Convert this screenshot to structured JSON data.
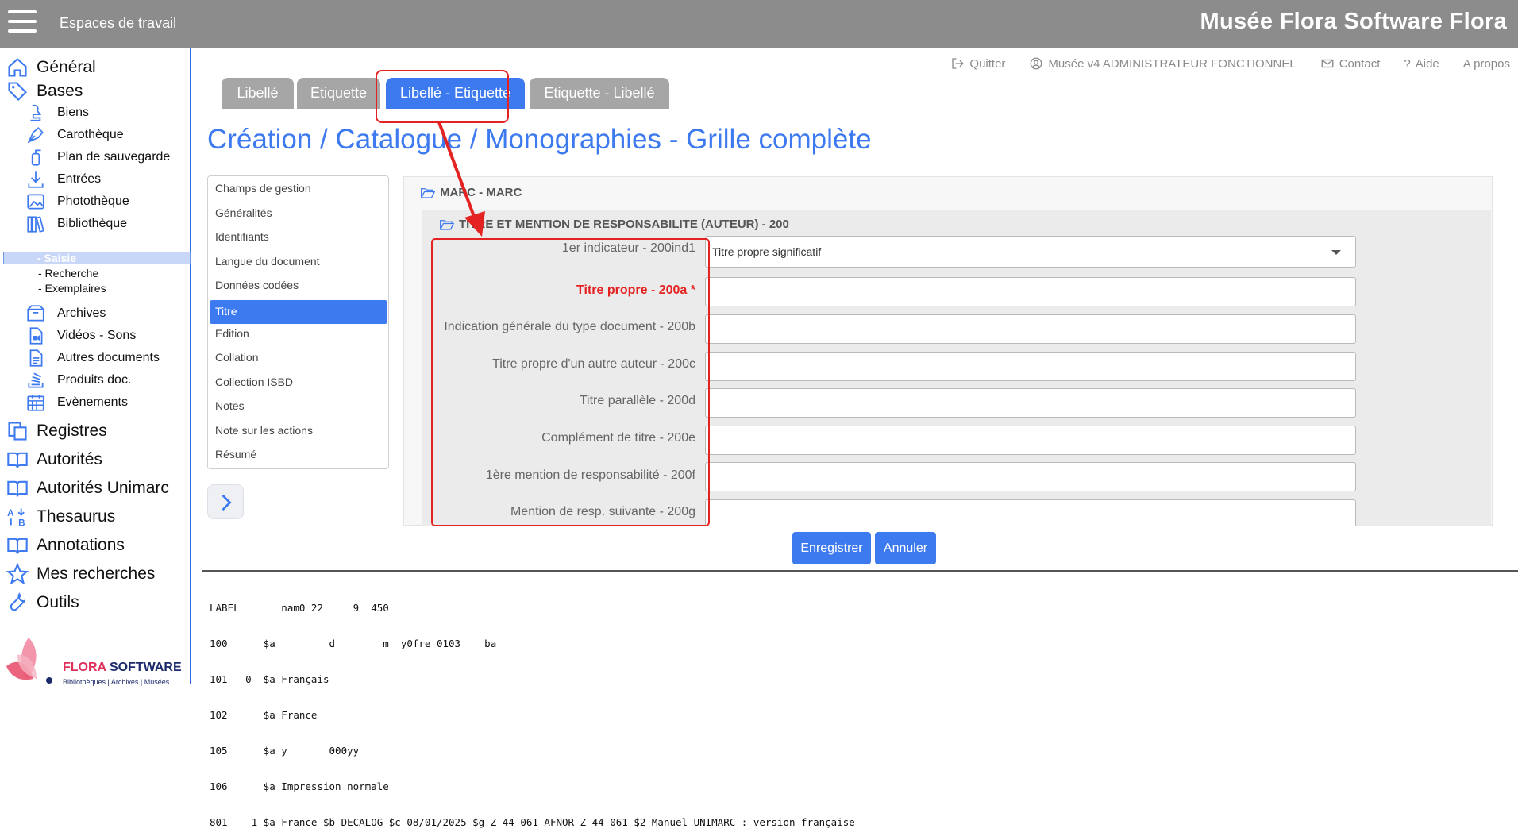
{
  "topbar": {
    "workspaces": "Espaces de travail",
    "brand": "Musée Flora Software Flora"
  },
  "sidebar": {
    "general": "Général",
    "bases": "Bases",
    "subs": [
      "Biens",
      "Carothèque",
      "Plan de sauvegarde",
      "Entrées",
      "Photothèque",
      "Bibliothèque"
    ],
    "biblio_leaves": [
      "- Saisie",
      "- Recherche",
      "- Exemplaires"
    ],
    "subs2": [
      "Archives",
      "Vidéos - Sons",
      "Autres documents",
      "Produits doc.",
      "Evènements"
    ],
    "tops": [
      "Registres",
      "Autorités",
      "Autorités Unimarc",
      "Thesaurus",
      "Annotations",
      "Mes recherches",
      "Outils"
    ],
    "logo": {
      "brand_a": "FLORA ",
      "brand_b": "SOFTWARE",
      "tagline": "Bibliothèques | Archives | Musées"
    }
  },
  "header_links": {
    "quit": "Quitter",
    "user": "Musée v4 ADMINISTRATEUR FONCTIONNEL",
    "contact": "Contact",
    "help": "Aide",
    "about": "A propos"
  },
  "tabs": [
    "Libellé",
    "Etiquette",
    "Libellé - Etiquette",
    "Etiquette - Libellé"
  ],
  "page_title": "Création / Catalogue / Monographies - Grille complète",
  "field_groups": [
    "Champs de gestion",
    "Généralités",
    "Identifiants",
    "Langue du document",
    "Données codées",
    "Titre",
    "Edition",
    "Collation",
    "Collection ISBD",
    "Notes",
    "Note sur les actions",
    "Résumé"
  ],
  "sections": {
    "marc": "MARC - MARC",
    "title_section": "TITRE ET MENTION DE RESPONSABILITE (AUTEUR) - 200"
  },
  "form": {
    "ind1_label": "1er indicateur - 200ind1",
    "ind1_value": "Titre propre significatif",
    "title_label": "Titre propre - 200a *",
    "labels": [
      "Indication générale du type document - 200b",
      "Titre propre d'un autre auteur - 200c",
      "Titre parallèle - 200d",
      "Complément de titre - 200e",
      "1ère mention de responsabilité - 200f",
      "Mention de resp. suivante - 200g"
    ]
  },
  "buttons": {
    "save": "Enregistrer",
    "cancel": "Annuler"
  },
  "marc_preview": [
    "LABEL       nam0 22     9  450",
    "100      $a         d        m  y0fre 0103    ba",
    "101   0  $a Français",
    "102      $a France",
    "105      $a y       000yy",
    "106      $a Impression normale",
    "801    1 $a France $b DECALOG $c 08/01/2025 $g Z 44-061 AFNOR Z 44-061 $2 Manuel UNIMARC : version française"
  ],
  "colors": {
    "accent": "#3d7af0",
    "topbar": "#8c8c8c",
    "highlight": "#e52222"
  }
}
